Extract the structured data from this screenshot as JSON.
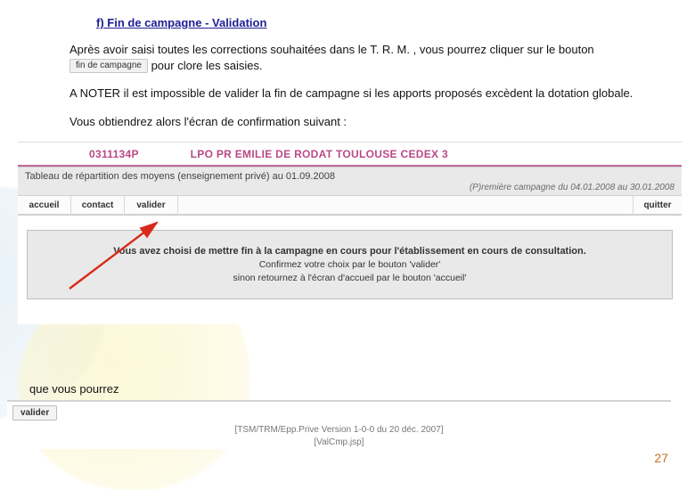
{
  "heading": "f) Fin de campagne - Validation",
  "para1_a": "Après avoir saisi toutes les corrections souhaitées dans le T. R. M. , vous pourrez cliquer sur le bouton ",
  "btn_fin": "fin de campagne",
  "para1_b": " pour clore les saisies.",
  "para2": "A NOTER il est  impossible de valider la fin de campagne si les apports proposés excèdent la dotation globale.",
  "para3": "Vous obtiendrez alors l'écran de confirmation suivant :",
  "school": {
    "code": "0311134P",
    "name": "LPO PR EMILIE DE RODAT TOULOUSE CEDEX 3"
  },
  "trm": {
    "title": "Tableau de répartition des moyens (enseignement privé) au 01.09.2008",
    "sub": "(P)remière campagne du 04.01.2008 au 30.01.2008"
  },
  "tabs": {
    "accueil": "accueil",
    "contact": "contact",
    "valider": "valider",
    "quitter": "quitter"
  },
  "confirm": {
    "l1": "Vous avez choisi de mettre fin à la campagne en cours pour l'établissement en cours de consultation.",
    "l2": "Confirmez votre choix par le bouton 'valider'",
    "l3": "sinon retournez à l'écran d'accueil par le bouton 'accueil'"
  },
  "footer_text": "que vous pourrez",
  "btn_valider": "valider",
  "meta1": "[TSM/TRM/Epp.Prive Version 1-0-0 du 20 déc. 2007]",
  "meta2": "[ValCmp.jsp]",
  "page_num": "27"
}
